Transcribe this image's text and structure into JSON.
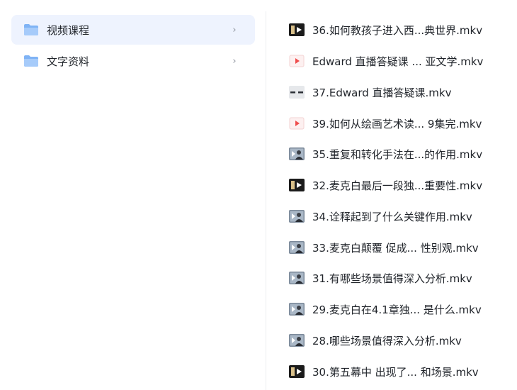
{
  "folders": [
    {
      "label": "视频课程",
      "selected": true
    },
    {
      "label": "文字资料",
      "selected": false
    }
  ],
  "chevron": "›",
  "files": [
    {
      "name": "36.如何教孩子进入西...典世界.mkv",
      "thumb": "video-dark"
    },
    {
      "name": "Edward 直播答疑课 ... 亚文学.mkv",
      "thumb": "video-play"
    },
    {
      "name": "37.Edward 直播答疑课.mkv",
      "thumb": "video-dash"
    },
    {
      "name": "39.如何从绘画艺术读...  9集完.mkv",
      "thumb": "video-play"
    },
    {
      "name": "35.重复和转化手法在...的作用.mkv",
      "thumb": "video-person"
    },
    {
      "name": "32.麦克白最后一段独...重要性.mkv",
      "thumb": "video-dark"
    },
    {
      "name": "34.诠释起到了什么关键作用.mkv",
      "thumb": "video-person"
    },
    {
      "name": "33.麦克白颠覆 促成...  性别观.mkv",
      "thumb": "video-person"
    },
    {
      "name": "31.有哪些场景值得深入分析.mkv",
      "thumb": "video-person"
    },
    {
      "name": "29.麦克白在4.1章独...  是什么.mkv",
      "thumb": "video-person"
    },
    {
      "name": "28.哪些场景值得深入分析.mkv",
      "thumb": "video-person"
    },
    {
      "name": "30.第五幕中 出现了...  和场景.mkv",
      "thumb": "video-dark"
    }
  ]
}
